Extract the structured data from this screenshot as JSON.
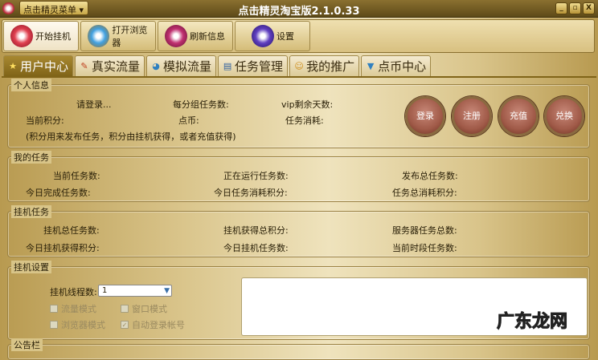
{
  "window": {
    "title": "点击精灵淘宝版2.1.0.33",
    "menu": "点击精灵菜单 ▾",
    "min": "_",
    "max": "▫",
    "close": "X"
  },
  "toolbar": [
    {
      "label": "开始挂机"
    },
    {
      "label": "打开浏览器"
    },
    {
      "label": "刷新信息"
    },
    {
      "label": "设置"
    }
  ],
  "tabs": [
    {
      "label": "用户中心",
      "icon": "★"
    },
    {
      "label": "真实流量",
      "icon": "✎"
    },
    {
      "label": "模拟流量",
      "icon": "◕"
    },
    {
      "label": "任务管理",
      "icon": "▤"
    },
    {
      "label": "我的推广",
      "icon": "☺"
    },
    {
      "label": "点币中心",
      "icon": "▼"
    }
  ],
  "personal": {
    "title": "个人信息",
    "login_prompt": "请登录...",
    "per_group": "每分组任务数:",
    "vip_days": "vip剩余天数:",
    "points": "当前积分:",
    "coins": "点币:",
    "task_cost": "任务消耗:",
    "note": "(积分用来发布任务，积分由挂机获得，或者充值获得)",
    "buttons": [
      "登录",
      "注册",
      "充值",
      "兑换"
    ]
  },
  "my_tasks": {
    "title": "我的任务",
    "current": "当前任务数:",
    "running": "正在运行任务数:",
    "published": "发布总任务数:",
    "today_done": "今日完成任务数:",
    "today_points": "今日任务消耗积分:",
    "total_points": "任务总消耗积分:"
  },
  "hang_tasks": {
    "title": "挂机任务",
    "total": "挂机总任务数:",
    "total_points": "挂机获得总积分:",
    "server_total": "服务器任务总数:",
    "today_points": "今日挂机获得积分:",
    "today_tasks": "今日挂机任务数:",
    "current_period": "当前时段任务数:"
  },
  "hang_settings": {
    "title": "挂机设置",
    "threads_label": "挂机线程数:",
    "threads_value": "1",
    "options": [
      {
        "label": "流量模式",
        "checked": false
      },
      {
        "label": "窗口模式",
        "checked": false
      },
      {
        "label": "浏览器模式",
        "checked": false
      },
      {
        "label": "自动登录帐号",
        "checked": true
      }
    ]
  },
  "notice": {
    "title": "公告栏"
  },
  "watermark": "广东龙网"
}
